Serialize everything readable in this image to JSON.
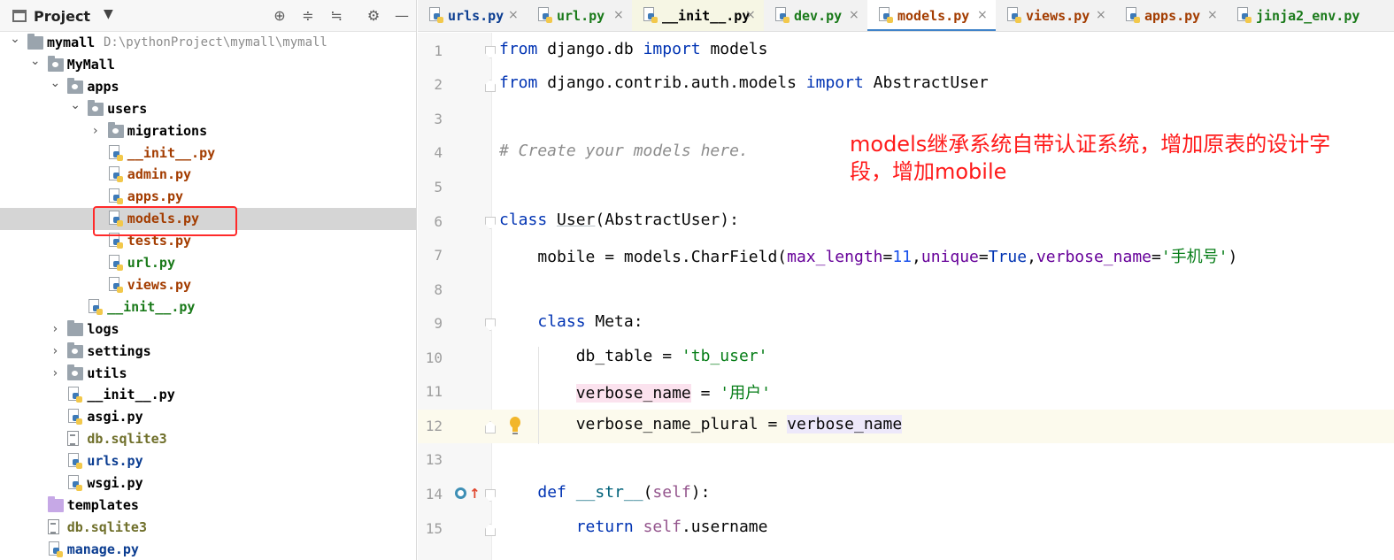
{
  "project_panel": {
    "title": "Project",
    "dropdown": "▼",
    "tools": [
      "⊕",
      "≑",
      "≒",
      "⚙",
      "—"
    ],
    "tree": [
      {
        "label": "mymall",
        "path": "D:\\pythonProject\\mymall\\mymall",
        "kind": "folder",
        "depth": 0,
        "expanded": true,
        "color": "#000000"
      },
      {
        "label": "MyMall",
        "kind": "pkg",
        "depth": 1,
        "expanded": true,
        "color": "#000000"
      },
      {
        "label": "apps",
        "kind": "pkg",
        "depth": 2,
        "expanded": true,
        "color": "#000000"
      },
      {
        "label": "users",
        "kind": "pkg",
        "depth": 3,
        "expanded": true,
        "color": "#000000"
      },
      {
        "label": "migrations",
        "kind": "pkg",
        "depth": 4,
        "expanded": false,
        "color": "#000000"
      },
      {
        "label": "__init__.py",
        "kind": "py",
        "depth": 4,
        "color": "#a33c00"
      },
      {
        "label": "admin.py",
        "kind": "py",
        "depth": 4,
        "color": "#a33c00"
      },
      {
        "label": "apps.py",
        "kind": "py",
        "depth": 4,
        "color": "#a33c00"
      },
      {
        "label": "models.py",
        "kind": "py",
        "depth": 4,
        "color": "#a33c00",
        "selected": true
      },
      {
        "label": "tests.py",
        "kind": "py",
        "depth": 4,
        "color": "#a33c00"
      },
      {
        "label": "url.py",
        "kind": "py",
        "depth": 4,
        "color": "#1a7a1a"
      },
      {
        "label": "views.py",
        "kind": "py",
        "depth": 4,
        "color": "#a33c00"
      },
      {
        "label": "__init__.py",
        "kind": "py",
        "depth": 3,
        "color": "#1a7a1a"
      },
      {
        "label": "logs",
        "kind": "folder",
        "depth": 2,
        "expanded": false,
        "color": "#000000"
      },
      {
        "label": "settings",
        "kind": "pkg",
        "depth": 2,
        "expanded": false,
        "color": "#000000"
      },
      {
        "label": "utils",
        "kind": "pkg",
        "depth": 2,
        "expanded": false,
        "color": "#000000"
      },
      {
        "label": "__init__.py",
        "kind": "py",
        "depth": 2,
        "color": "#000000"
      },
      {
        "label": "asgi.py",
        "kind": "py",
        "depth": 2,
        "color": "#000000"
      },
      {
        "label": "db.sqlite3",
        "kind": "db",
        "depth": 2,
        "color": "#6f6f2a"
      },
      {
        "label": "urls.py",
        "kind": "py",
        "depth": 2,
        "color": "#0b3d91"
      },
      {
        "label": "wsgi.py",
        "kind": "py",
        "depth": 2,
        "color": "#000000"
      },
      {
        "label": "templates",
        "kind": "purple",
        "depth": 1,
        "color": "#000000"
      },
      {
        "label": "db.sqlite3",
        "kind": "db",
        "depth": 1,
        "color": "#6f6f2a"
      },
      {
        "label": "manage.py",
        "kind": "py",
        "depth": 1,
        "color": "#0b3d91"
      }
    ]
  },
  "tabs": [
    {
      "label": "urls.py",
      "color": "#0b3d91",
      "active": false
    },
    {
      "label": "url.py",
      "color": "#1a7a1a",
      "active": false
    },
    {
      "label": "__init__.py",
      "color": "#000000",
      "active": false,
      "modified": true
    },
    {
      "label": "dev.py",
      "color": "#1a7a1a",
      "active": false
    },
    {
      "label": "models.py",
      "color": "#a33c00",
      "active": true
    },
    {
      "label": "views.py",
      "color": "#a33c00",
      "active": false
    },
    {
      "label": "apps.py",
      "color": "#a33c00",
      "active": false
    },
    {
      "label": "jinja2_env.py",
      "color": "#1a7a1a",
      "active": false
    }
  ],
  "close_glyph": "×",
  "editor": {
    "line_numbers": [
      "1",
      "2",
      "3",
      "4",
      "5",
      "6",
      "7",
      "8",
      "9",
      "10",
      "11",
      "12",
      "13",
      "14",
      "15"
    ],
    "current_line": 12,
    "code": {
      "l1": {
        "kw1": "from",
        "t1": " django.db ",
        "kw2": "import",
        "t2": " models"
      },
      "l2": {
        "kw1": "from",
        "t1": " django.contrib.auth.models ",
        "kw2": "import",
        "t2": " AbstractUser"
      },
      "l4": {
        "comment": "# Create your models here."
      },
      "l6": {
        "kw": "class",
        "sp": " ",
        "cls": "User",
        "t": "(AbstractUser):"
      },
      "l7": {
        "indent": "    ",
        "t1": "mobile = models.CharField(",
        "p1": "max_length",
        "e1": "=",
        "n1": "11",
        "c1": ",",
        "p2": "unique",
        "e2": "=",
        "k1": "True",
        "c2": ",",
        "p3": "verbose_name",
        "e3": "=",
        "s1": "'手机号'",
        "t2": ")"
      },
      "l9": {
        "indent": "    ",
        "kw": "class",
        "t": " Meta:"
      },
      "l10": {
        "indent": "        ",
        "t1": "db_table = ",
        "s1": "'tb_user'"
      },
      "l11": {
        "indent": "        ",
        "v": "verbose_name",
        "t1": " = ",
        "s1": "'用户'"
      },
      "l12": {
        "indent": "        ",
        "t1": "verbose_name_plural = ",
        "v": "verbose_name"
      },
      "l14": {
        "indent": "    ",
        "kw": "def",
        "sp": " ",
        "fn": "__str__",
        "t1": "(",
        "self": "self",
        "t2": "):"
      },
      "l15": {
        "indent": "        ",
        "kw": "return",
        "sp": " ",
        "self": "self",
        "t": ".username"
      }
    }
  },
  "annotation": "models继承系统自带认证系统，增加原表的设计字段，增加mobile"
}
